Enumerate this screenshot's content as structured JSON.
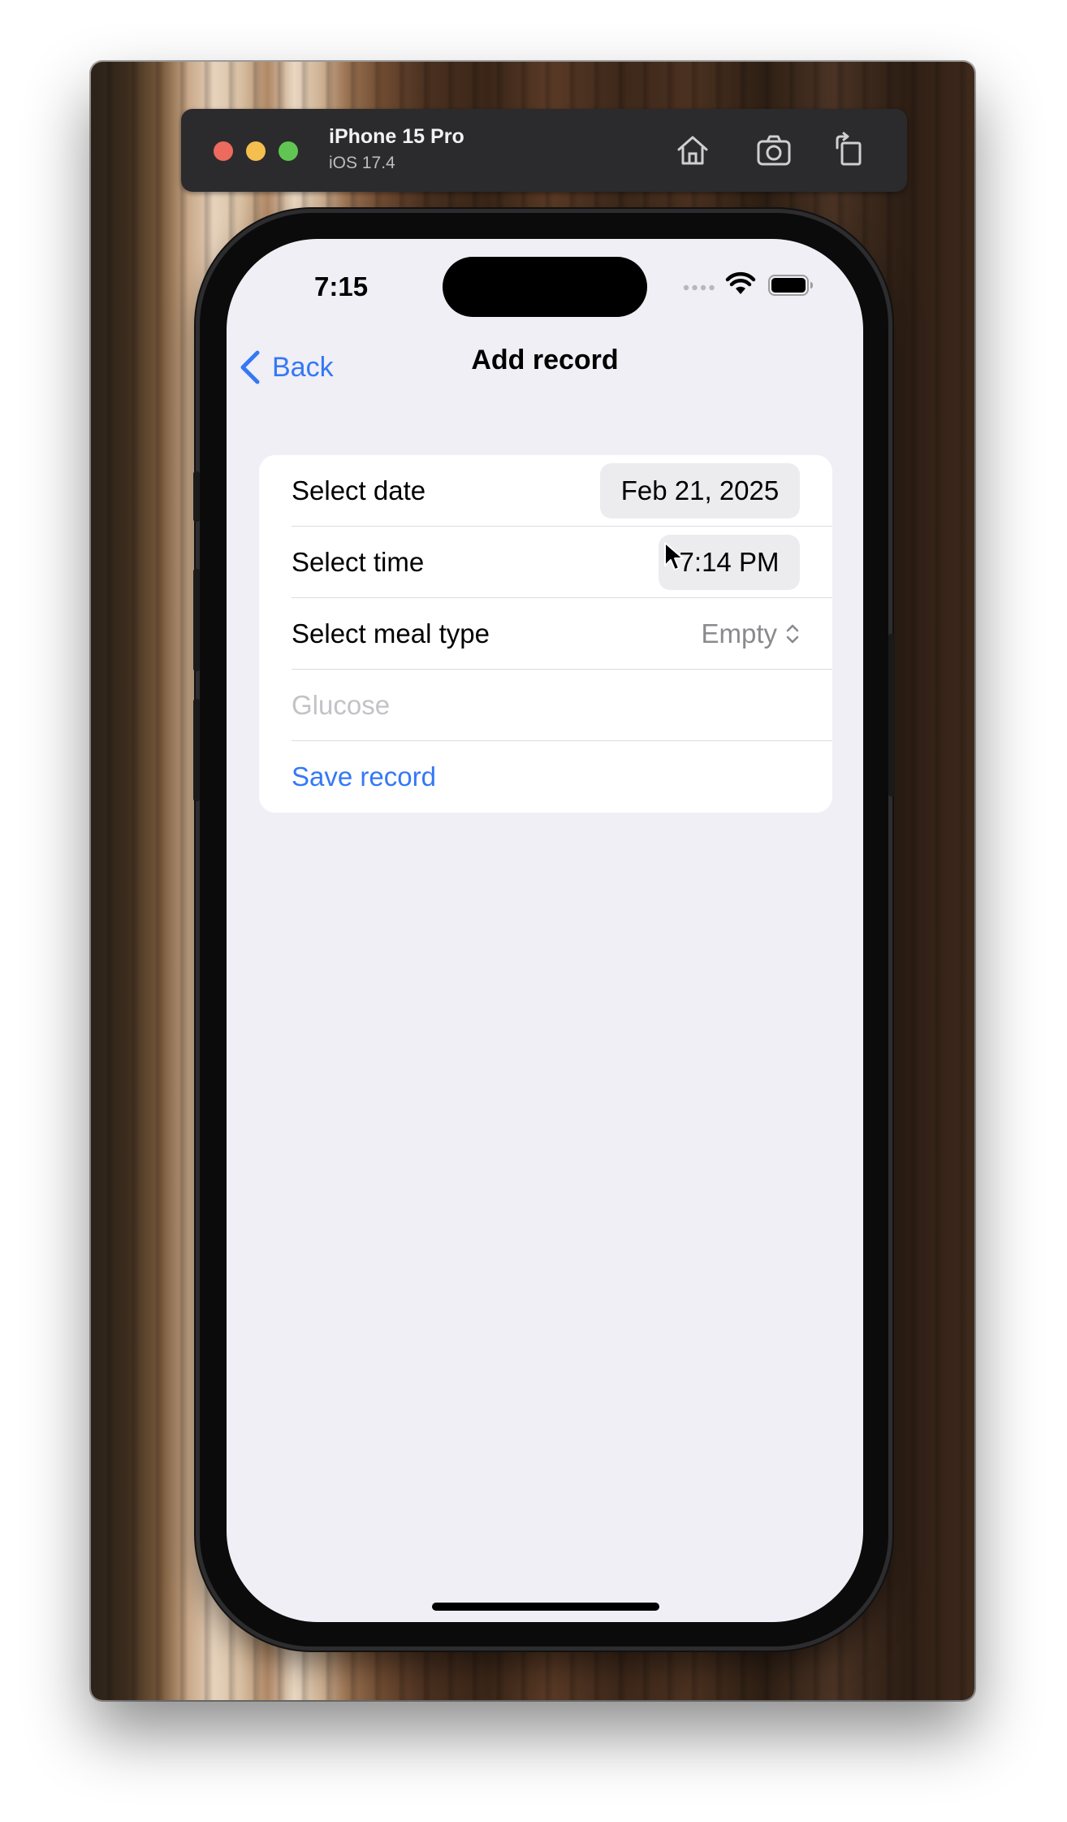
{
  "simulator": {
    "device_name": "iPhone 15 Pro",
    "os_version": "iOS 17.4",
    "toolbar_icons": [
      "home-icon",
      "screenshot-icon",
      "rotate-icon"
    ],
    "traffic_light_colors": [
      "#ed6a5e",
      "#f4bf4f",
      "#61c554"
    ]
  },
  "status_bar": {
    "time": "7:15",
    "icons": [
      "cellular-icon",
      "wifi-icon",
      "battery-icon"
    ]
  },
  "nav": {
    "back_label": "Back",
    "title": "Add record"
  },
  "form": {
    "date_label": "Select date",
    "date_value": "Feb 21, 2025",
    "time_label": "Select time",
    "time_value": "7:14 PM",
    "meal_label": "Select meal type",
    "meal_value": "Empty",
    "glucose_placeholder": "Glucose",
    "glucose_value": "",
    "save_label": "Save record"
  },
  "colors": {
    "accent": "#3478f6",
    "background": "#f0eff5",
    "card": "#ffffff",
    "placeholder": "#c3c3c7",
    "secondary_text": "#8a8a8e"
  }
}
